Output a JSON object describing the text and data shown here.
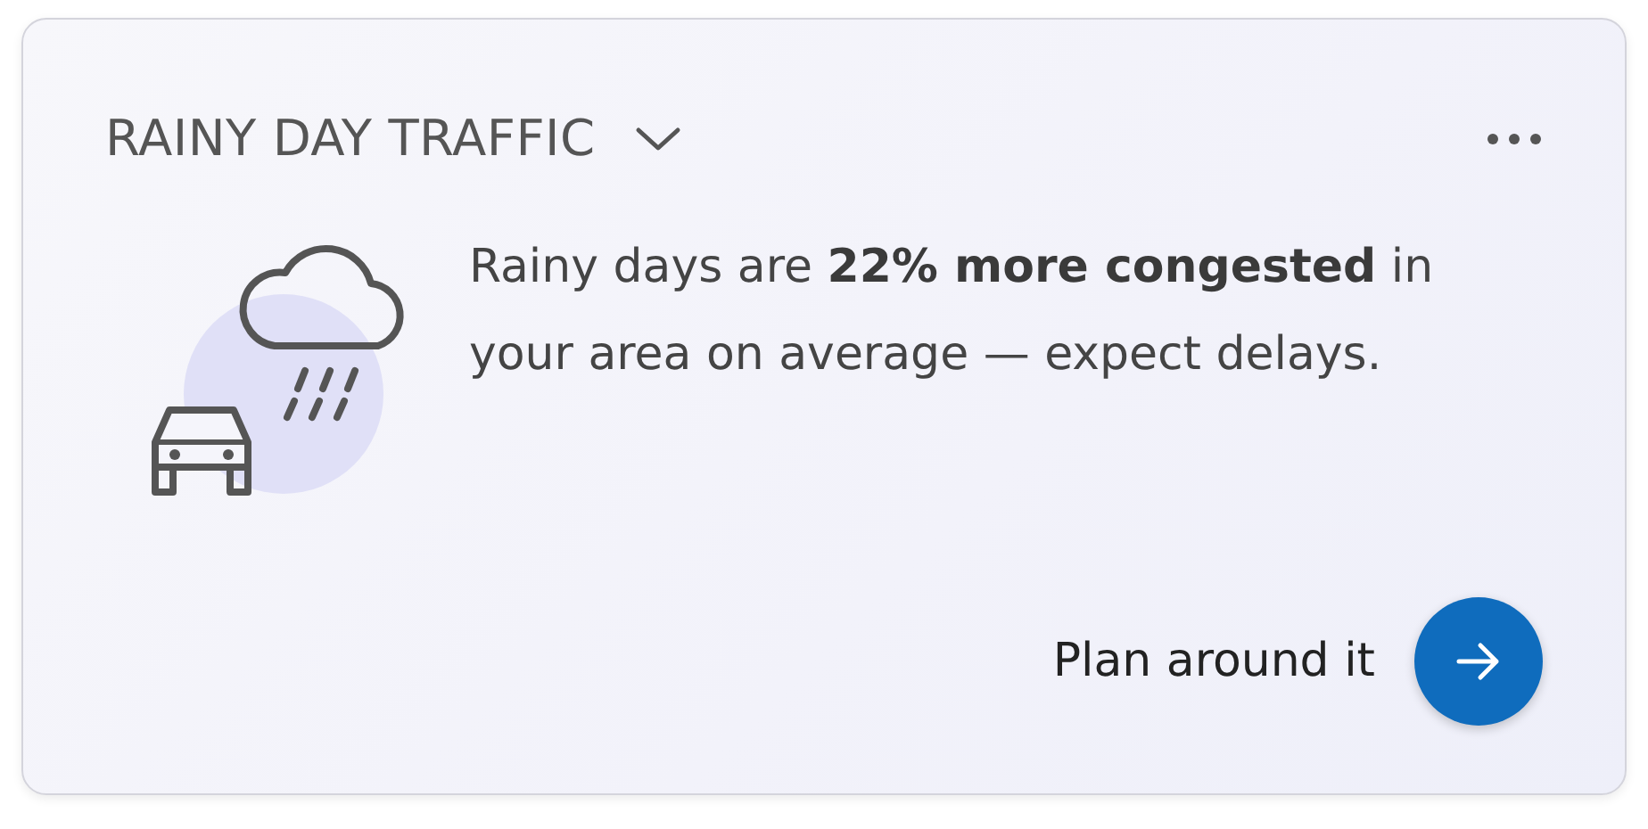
{
  "card": {
    "title": "RAINY DAY TRAFFIC",
    "message": "Rainy days are **22% more congested** in your area on average — expect delays.",
    "action": {
      "label": "Plan around it"
    }
  }
}
